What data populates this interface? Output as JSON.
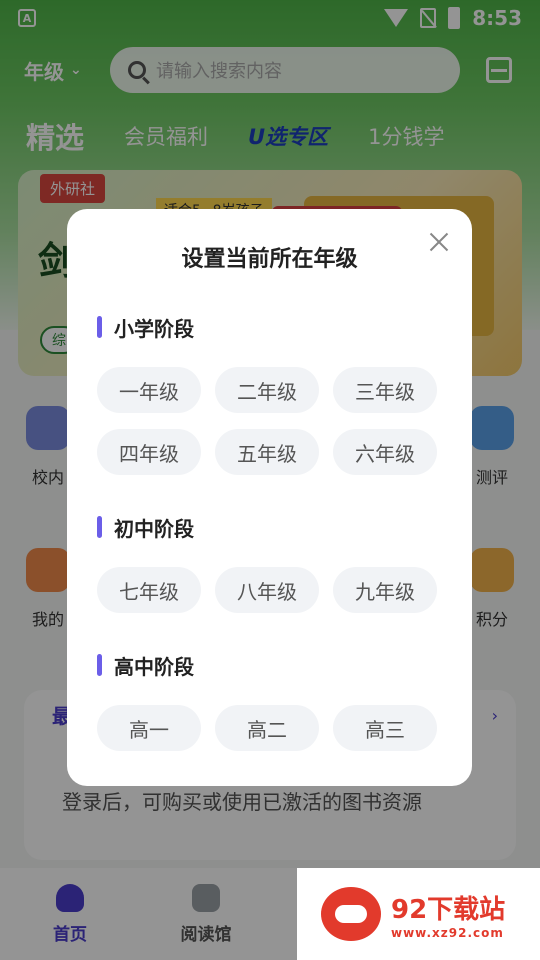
{
  "status_bar": {
    "time": "8:53",
    "app_icon_letter": "A"
  },
  "header": {
    "grade_selector": "年级",
    "search_placeholder": "请输入搜索内容"
  },
  "tabs": [
    "精选",
    "会员福利",
    "U选专区",
    "1分钱学"
  ],
  "banner": {
    "publisher_tag": "外研社",
    "big_text": "剑",
    "strip_text": "适合5~8岁孩子",
    "pill_text": "综"
  },
  "icon_row_1": [
    "校内",
    "测评"
  ],
  "icon_row_2": [
    "我的",
    "积分"
  ],
  "login_card": {
    "title": "最",
    "text": "登录后，可购买或使用已激活的图书资源"
  },
  "bottom_nav": [
    {
      "label": "首页",
      "icon": "home-icon"
    },
    {
      "label": "阅读馆",
      "icon": "book-icon"
    }
  ],
  "modal": {
    "title": "设置当前所在年级",
    "sections": [
      {
        "title": "小学阶段",
        "grades": [
          "一年级",
          "二年级",
          "三年级",
          "四年级",
          "五年级",
          "六年级"
        ]
      },
      {
        "title": "初中阶段",
        "grades": [
          "七年级",
          "八年级",
          "九年级"
        ]
      },
      {
        "title": "高中阶段",
        "grades": [
          "高一",
          "高二",
          "高三"
        ]
      }
    ]
  },
  "watermark": {
    "name": "92下载站",
    "url": "www.xz92.com"
  },
  "colors": {
    "accent": "#6b5ee8",
    "header_green": "#4fb548",
    "nav_active": "#4a3dcc"
  }
}
